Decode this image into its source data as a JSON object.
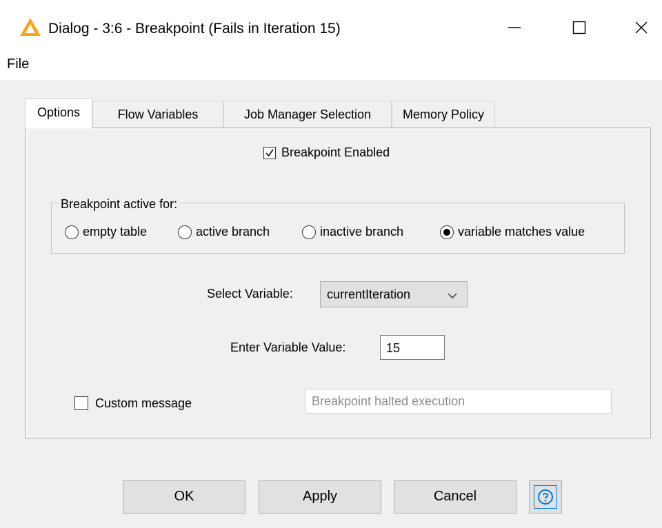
{
  "window": {
    "title": "Dialog - 3:6 - Breakpoint (Fails in Iteration 15)",
    "icon": "warning-triangle-icon",
    "accent_color": "#f5a623"
  },
  "menu": {
    "file_label": "File"
  },
  "tabs": [
    {
      "label": "Options",
      "active": true
    },
    {
      "label": "Flow Variables",
      "active": false
    },
    {
      "label": "Job Manager Selection",
      "active": false
    },
    {
      "label": "Memory Policy",
      "active": false
    }
  ],
  "options": {
    "breakpoint_enabled_label": "Breakpoint Enabled",
    "breakpoint_enabled": true,
    "group_label": "Breakpoint active for:",
    "radios": [
      {
        "label": "empty table",
        "selected": false
      },
      {
        "label": "active branch",
        "selected": false
      },
      {
        "label": "inactive branch",
        "selected": false
      },
      {
        "label": "variable matches value",
        "selected": true
      }
    ],
    "select_variable_label": "Select Variable:",
    "select_variable_value": "currentIteration",
    "variable_value_label": "Enter Variable Value:",
    "variable_value": "15",
    "custom_message_label": "Custom message",
    "custom_message_checked": false,
    "custom_message_value": "Breakpoint halted execution"
  },
  "buttons": {
    "ok": "OK",
    "apply": "Apply",
    "cancel": "Cancel",
    "help_icon": "help-icon"
  }
}
